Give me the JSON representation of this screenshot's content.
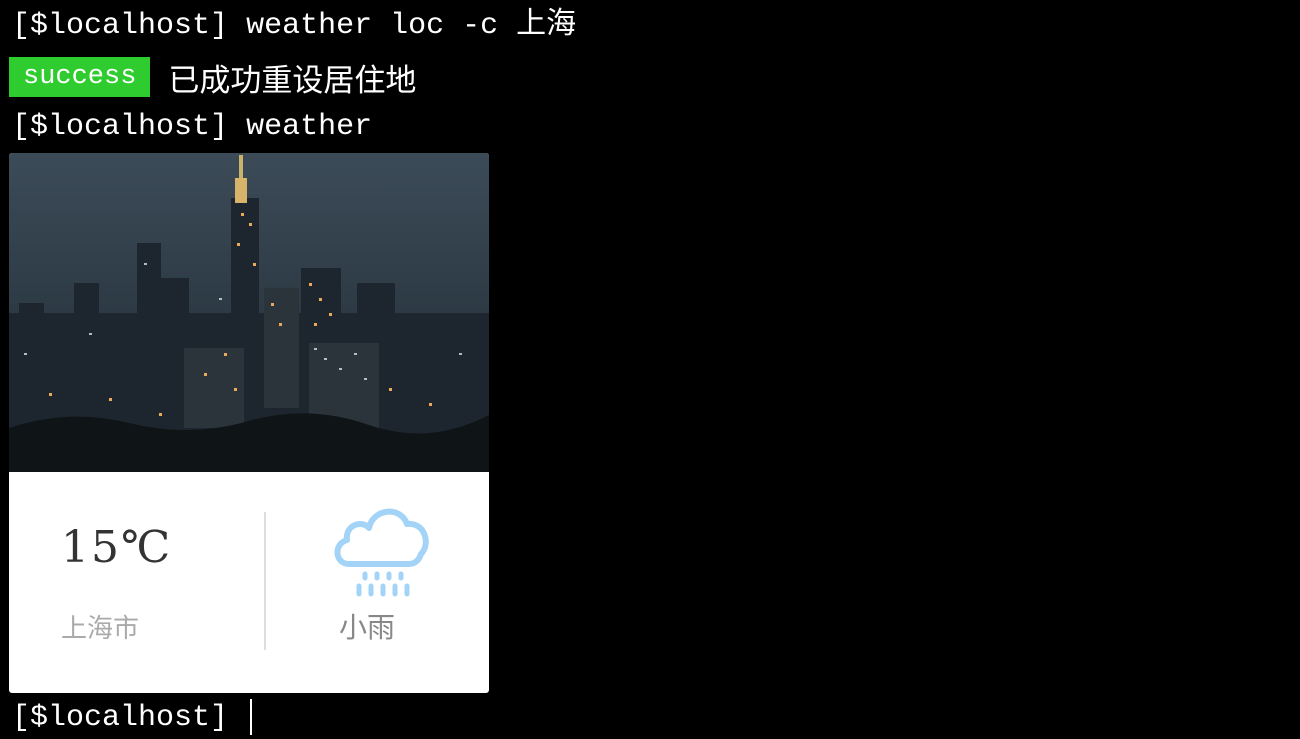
{
  "terminal": {
    "lines": [
      {
        "prompt": "[$localhost]",
        "command": "weather loc -c 上海"
      },
      {
        "prompt": "[$localhost]",
        "command": "weather"
      },
      {
        "prompt": "[$localhost]",
        "command": ""
      }
    ],
    "status": {
      "badge_label": "success",
      "badge_color": "#2ecc2e",
      "message": "已成功重设居住地"
    }
  },
  "weather_card": {
    "temperature": "15℃",
    "city": "上海市",
    "condition": "小雨",
    "icon": "rain-cloud-icon",
    "icon_color": "#a3d4f7",
    "photo": "city-skyline-night-photo"
  }
}
